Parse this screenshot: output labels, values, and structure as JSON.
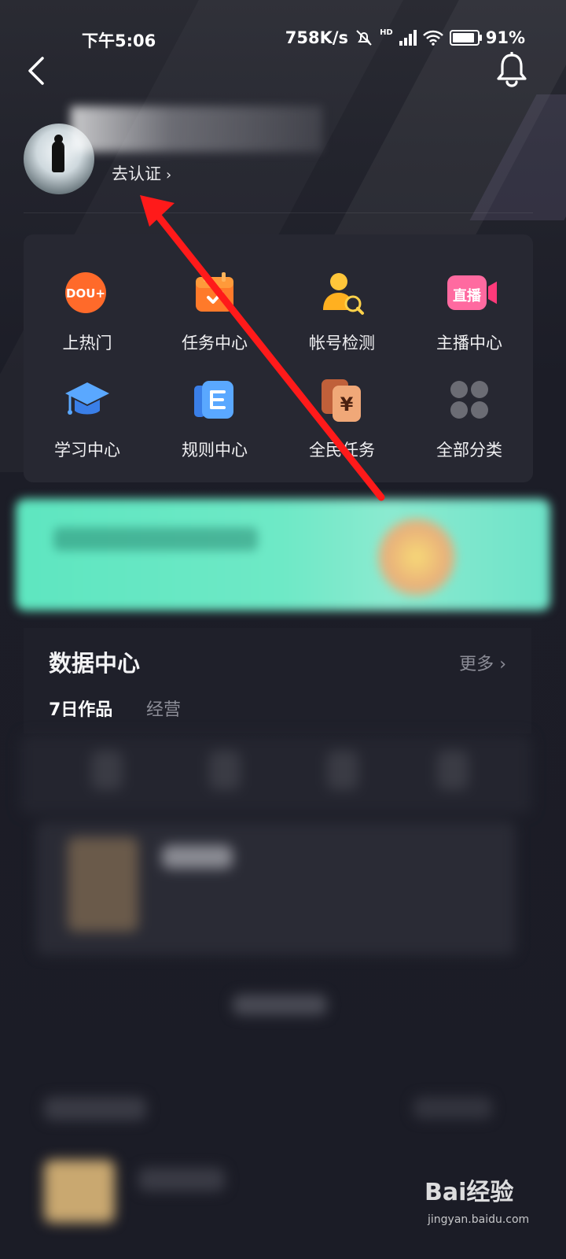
{
  "status_bar": {
    "time": "下午5:06",
    "network_speed": "758K/s",
    "network_badge": "HD",
    "battery": "91%"
  },
  "profile": {
    "verify_label": "去认证"
  },
  "grid": [
    {
      "label": "上热门",
      "icon": "dou-plus-icon"
    },
    {
      "label": "任务中心",
      "icon": "task-calendar-icon"
    },
    {
      "label": "帐号检测",
      "icon": "account-check-icon"
    },
    {
      "label": "主播中心",
      "icon": "live-camera-icon"
    },
    {
      "label": "学习中心",
      "icon": "graduation-cap-icon"
    },
    {
      "label": "规则中心",
      "icon": "rules-book-icon"
    },
    {
      "label": "全民任务",
      "icon": "yuan-cards-icon"
    },
    {
      "label": "全部分类",
      "icon": "all-categories-icon"
    }
  ],
  "grid_icon_texts": {
    "dou": "DOU+",
    "live": "直播",
    "yuan": "¥"
  },
  "data_center": {
    "title": "数据中心",
    "more": "更多",
    "tabs": [
      "7日作品",
      "经营"
    ]
  },
  "watermark": {
    "logo": "Bai经验",
    "url": "jingyan.baidu.com"
  },
  "colors": {
    "background": "#1b1c26",
    "card": "#272832",
    "banner": "#6ee9c6",
    "arrow": "#ff1a1a",
    "orange": "#ff6a2a"
  }
}
